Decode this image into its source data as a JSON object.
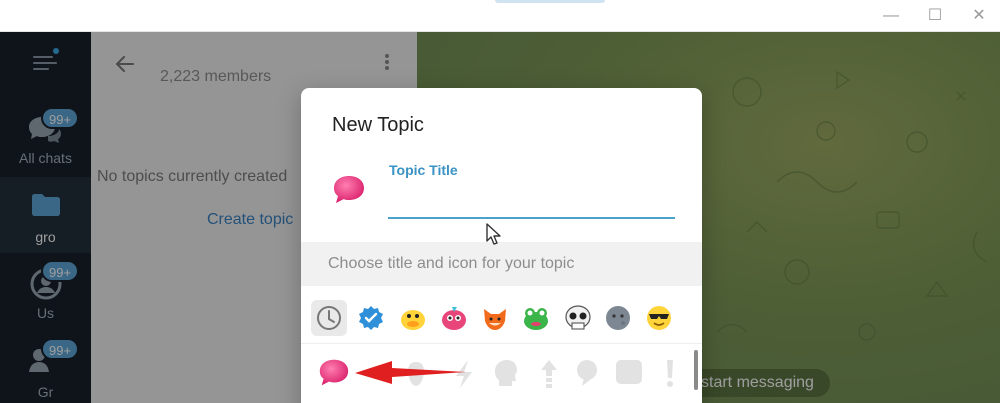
{
  "window": {
    "minimize": "—",
    "maximize": "☐",
    "close": "✕"
  },
  "sidebar": {
    "folders": [
      {
        "label": "All chats",
        "badge": "99+",
        "icon": "chats-icon"
      },
      {
        "label": "gro",
        "badge": "",
        "icon": "folder-icon"
      },
      {
        "label": "Us",
        "badge": "99+",
        "icon": "user-icon"
      },
      {
        "label": "Gr",
        "badge": "99+",
        "icon": "group-icon"
      }
    ]
  },
  "topics_panel": {
    "members": "2,223 members",
    "empty_text": "No topics currently created",
    "create_link": "Create topic"
  },
  "chat": {
    "start_hint": "start messaging"
  },
  "dialog": {
    "title": "New Topic",
    "field_label": "Topic Title",
    "field_value": "",
    "hint": "Choose title and icon for your topic",
    "tab_icons": [
      "recent-icon",
      "verified-icon",
      "duck-icon",
      "pink-creature-icon",
      "fox-icon",
      "frog-icon",
      "skull-icon",
      "moon-face-icon",
      "cool-face-icon"
    ],
    "grid_icons": [
      "pink-bubble-icon",
      "heart-shape-icon",
      "bulb-icon",
      "lightning-icon",
      "head-icon",
      "arrow-up-icon",
      "speech-icon",
      "square-icon",
      "exclamation-icon"
    ]
  },
  "colors": {
    "accent": "#3a93c4",
    "sidebar_bg": "#17212b",
    "badge": "#5fa6d9",
    "annotation_arrow": "#e02020",
    "topic_icon": "#ee3f85"
  }
}
